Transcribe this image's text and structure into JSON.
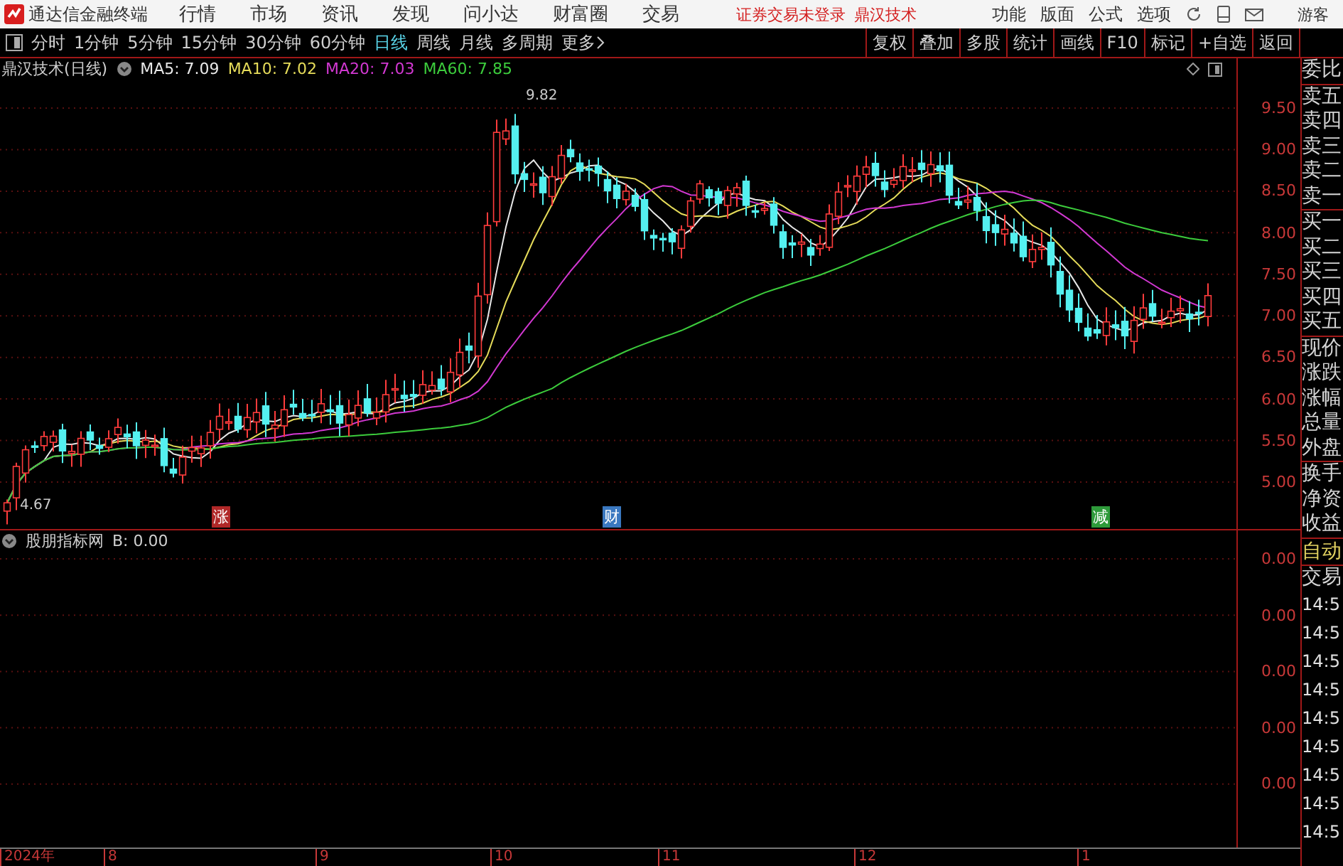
{
  "menu_bar": {
    "app_title": "通达信金融终端",
    "menus": [
      "行情",
      "市场",
      "资讯",
      "发现",
      "问小达",
      "财富圈",
      "交易"
    ],
    "login_notice": "证券交易未登录",
    "stock_name": "鼎汉技术",
    "tools": [
      "功能",
      "版面",
      "公式",
      "选项"
    ],
    "user": "游客"
  },
  "period_tabs": [
    {
      "label": "分时",
      "selected": false
    },
    {
      "label": "1分钟",
      "selected": false
    },
    {
      "label": "5分钟",
      "selected": false
    },
    {
      "label": "15分钟",
      "selected": false
    },
    {
      "label": "30分钟",
      "selected": false
    },
    {
      "label": "60分钟",
      "selected": false
    },
    {
      "label": "日线",
      "selected": true
    },
    {
      "label": "周线",
      "selected": false
    },
    {
      "label": "月线",
      "selected": false
    },
    {
      "label": "多周期",
      "selected": false
    }
  ],
  "more_button": "更多",
  "action_buttons": [
    "复权",
    "叠加",
    "多股",
    "统计",
    "画线",
    "F10",
    "标记",
    "+自选",
    "返回"
  ],
  "price_chart": {
    "title": "鼎汉技术(日线)",
    "moving_averages": [
      {
        "label": "MA5: 7.09",
        "color": "#e8e8e8"
      },
      {
        "label": "MA10: 7.02",
        "color": "#e6dc5a"
      },
      {
        "label": "MA20: 7.03",
        "color": "#d238d2"
      },
      {
        "label": "MA60: 7.85",
        "color": "#3ccc3c"
      }
    ],
    "axis_labels": [
      "9.50",
      "9.00",
      "8.50",
      "8.00",
      "7.50",
      "7.00",
      "6.50",
      "6.00",
      "5.50",
      "5.00"
    ],
    "high_label": "9.82",
    "low_label": "4.67",
    "event_markers": [
      {
        "label": "涨",
        "color": "#b02828"
      },
      {
        "label": "财",
        "color": "#3a78c0"
      },
      {
        "label": "减",
        "color": "#2e9a3a"
      }
    ]
  },
  "indicator_panel": {
    "title": "股朋指标网",
    "reading": "B: 0.00",
    "axis_labels": [
      "0.00",
      "0.00",
      "0.00",
      "0.00",
      "0.00"
    ]
  },
  "date_axis": [
    "2024年",
    "8",
    "9",
    "10",
    "11",
    "12",
    "1"
  ],
  "quote_panel": {
    "groups": [
      {
        "labels": [
          "委比"
        ]
      },
      {
        "labels": [
          "卖五",
          "卖四",
          "卖三",
          "卖二",
          "卖一"
        ]
      },
      {
        "labels": [
          "买一",
          "买二",
          "买三",
          "买四",
          "买五"
        ]
      },
      {
        "labels": [
          "现价",
          "涨跌",
          "涨幅",
          "总量",
          "外盘"
        ]
      },
      {
        "labels": [
          "换手",
          "净资",
          "收益"
        ]
      }
    ],
    "mode_button": "自动",
    "trade_label": "交易",
    "times": [
      "14:5",
      "14:5",
      "14:5",
      "14:5",
      "14:5",
      "14:5",
      "14:5",
      "14:5",
      "14:5"
    ]
  }
}
